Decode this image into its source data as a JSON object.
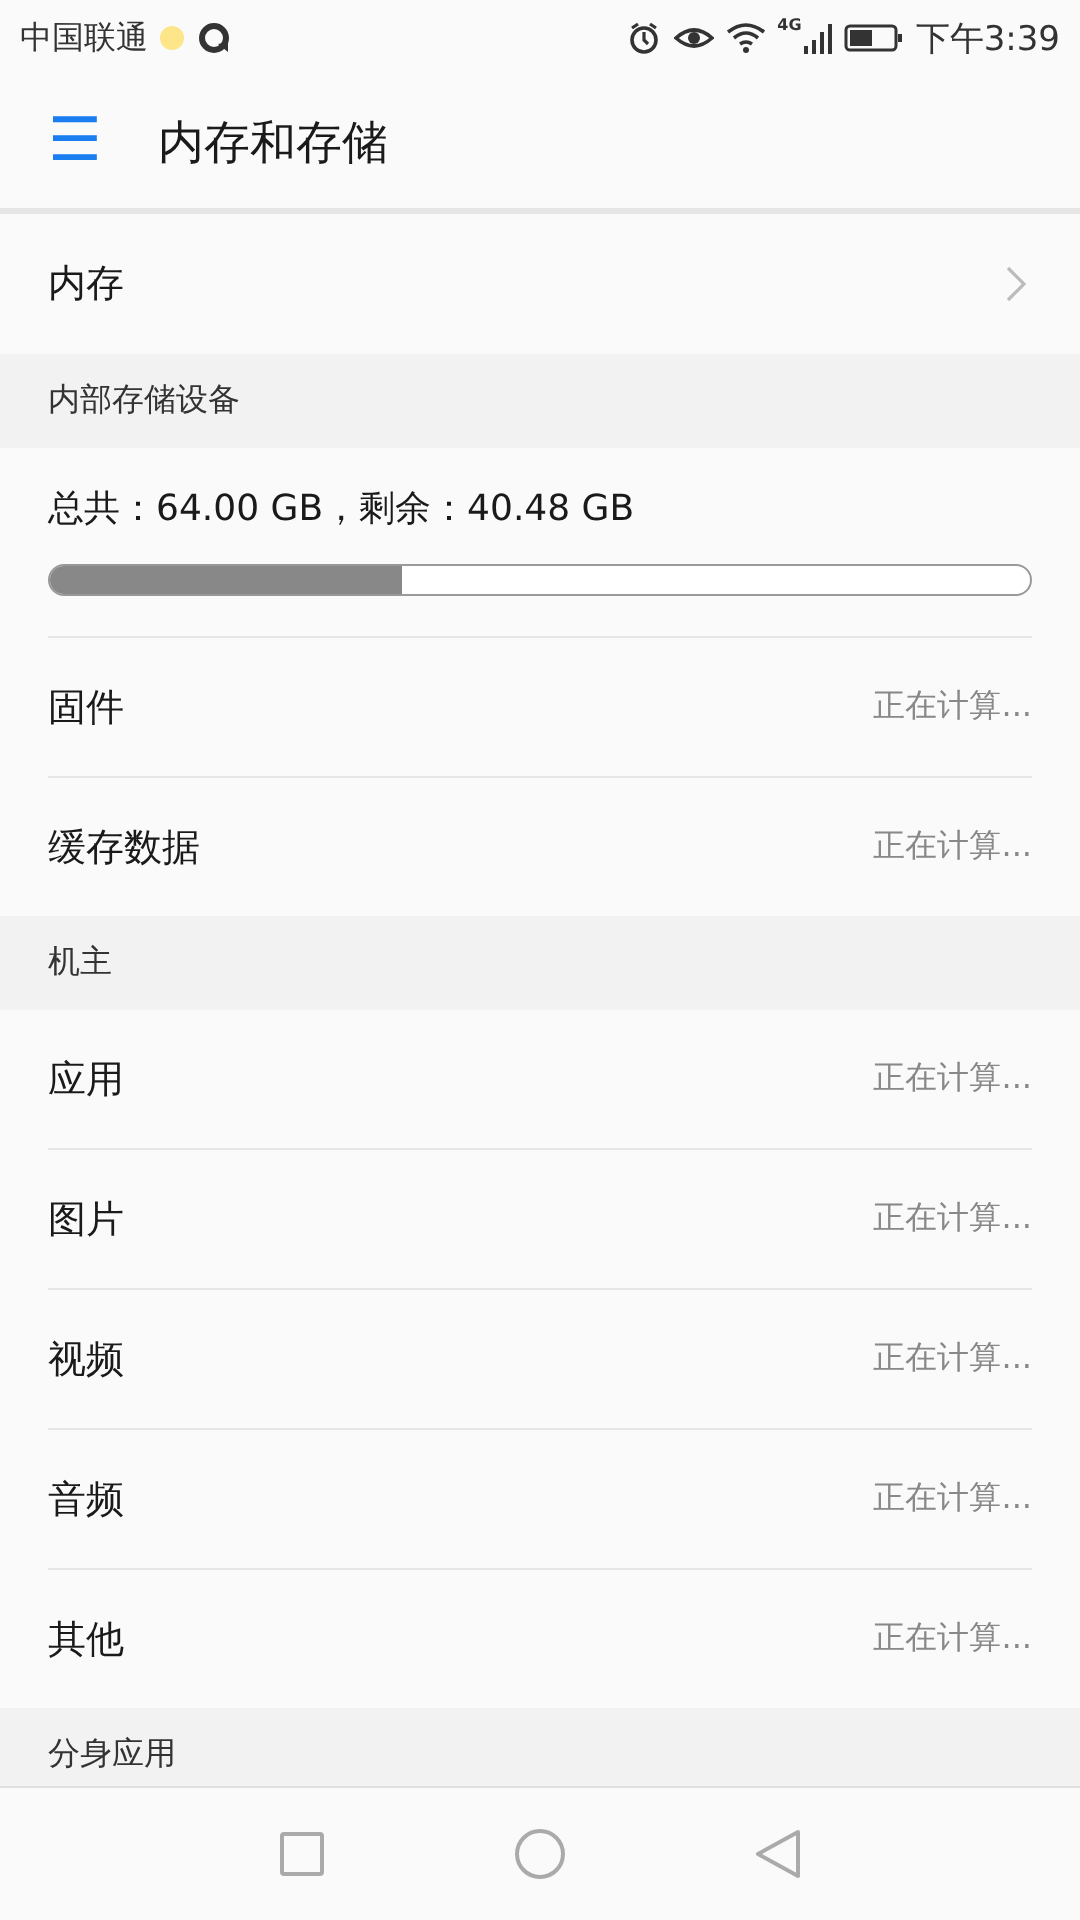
{
  "status_bar": {
    "carrier": "中国联通",
    "network": "4G",
    "time": "下午3:39"
  },
  "app_bar": {
    "menu_icon": "☰",
    "title": "内存和存储"
  },
  "memory_row": {
    "label": "内存"
  },
  "sections": [
    {
      "title": "内部存储设备",
      "summary": "总共：64.00 GB，剩余：40.48 GB",
      "level": 0.36,
      "rows": [
        {
          "label": "固件",
          "value": "正在计算..."
        },
        {
          "label": "缓存数据",
          "value": "正在计算..."
        }
      ]
    },
    {
      "title": "机主",
      "rows": [
        {
          "label": "应用",
          "value": "正在计算..."
        },
        {
          "label": "图片",
          "value": "正在计算..."
        },
        {
          "label": "视频",
          "value": "正在计算..."
        },
        {
          "label": "音频",
          "value": "正在计算..."
        },
        {
          "label": "其他",
          "value": "正在计算..."
        }
      ]
    },
    {
      "title": "分身应用"
    }
  ]
}
